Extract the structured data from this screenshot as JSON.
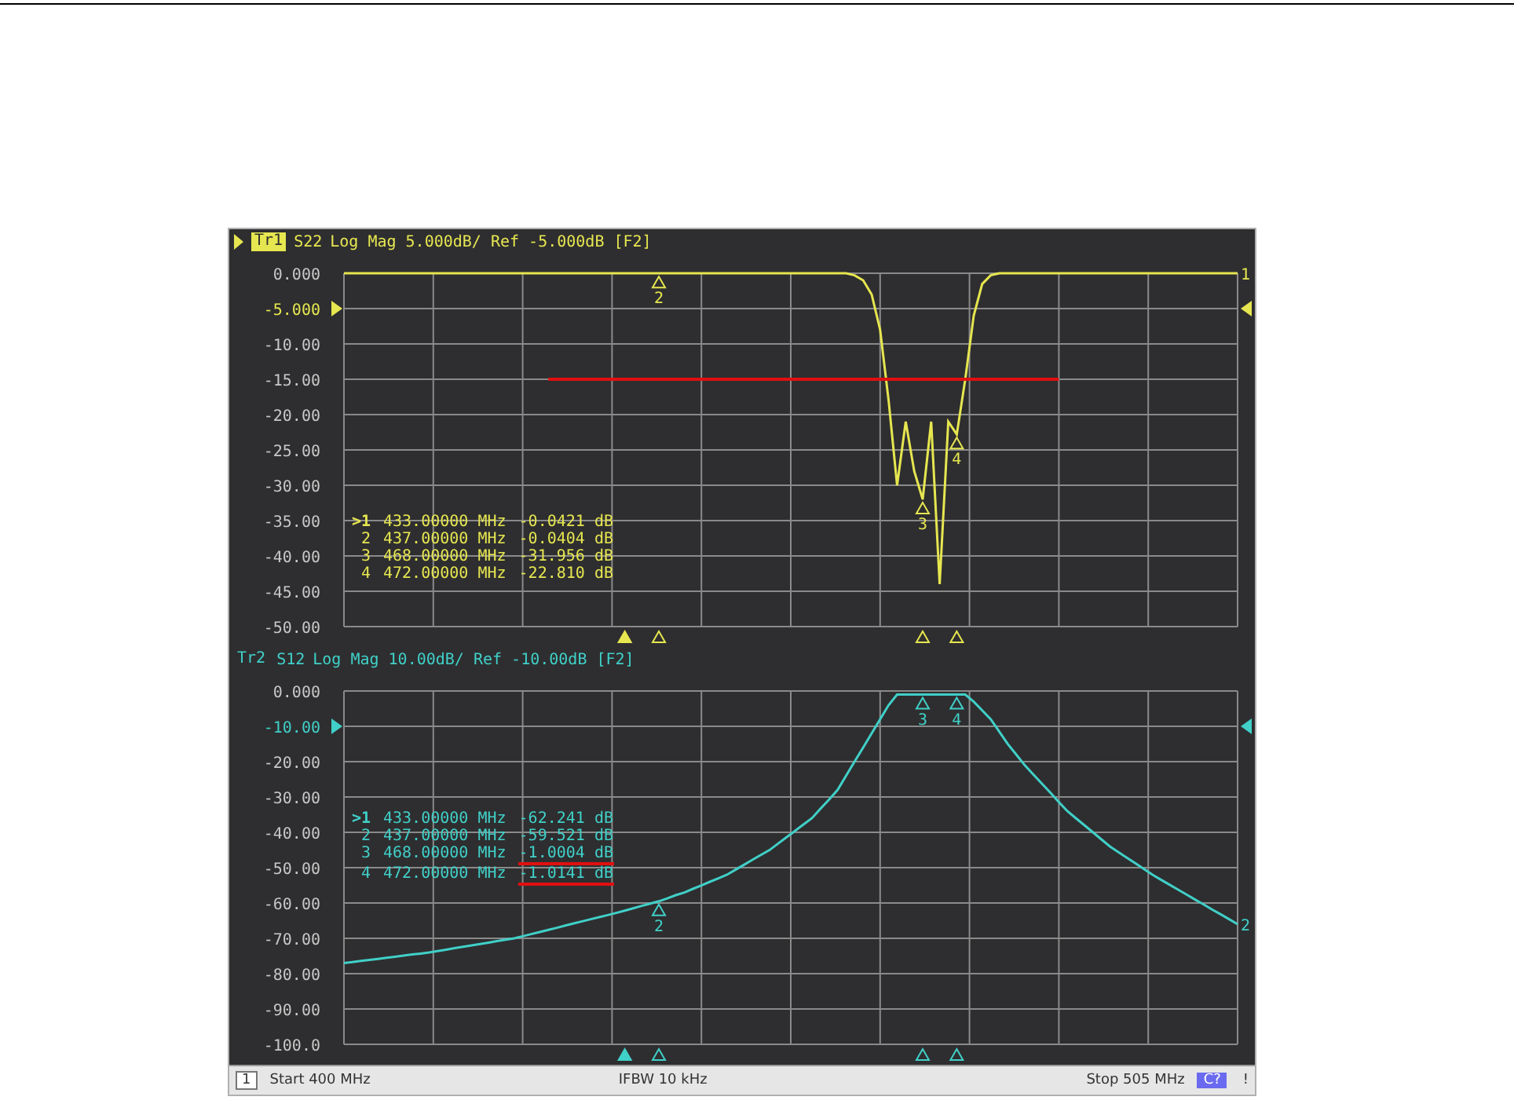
{
  "panels": [
    {
      "trace": "Tr1",
      "selected": true,
      "header": "Log Mag 5.000dB/ Ref -5.000dB [F2]",
      "trace_label": "1",
      "markers": [
        {
          "label": ">1",
          "active": true,
          "frequency": "433.00000 MHz",
          "value": "-0.0421 dB",
          "underlined": false
        },
        {
          "label": "2",
          "active": false,
          "frequency": "437.00000 MHz",
          "value": "-0.0404 dB",
          "underlined": false
        },
        {
          "label": "3",
          "active": false,
          "frequency": "468.00000 MHz",
          "value": "-31.956 dB",
          "underlined": false
        },
        {
          "label": "4",
          "active": false,
          "frequency": "472.00000 MHz",
          "value": "-22.810 dB",
          "underlined": false
        }
      ],
      "flags": [
        {
          "label": "2"
        },
        {
          "label": "3"
        },
        {
          "label": "4"
        }
      ],
      "chart_data": {
        "type": "line",
        "ylim": [
          -50,
          0
        ],
        "grid": true,
        "yticks": [
          {
            "value": 0,
            "label": "0.000"
          },
          {
            "value": -5,
            "label": "-5.000"
          },
          {
            "value": -10,
            "label": "-10.00"
          },
          {
            "value": -15,
            "label": "-15.00"
          },
          {
            "value": -20,
            "label": "-20.00"
          },
          {
            "value": -25,
            "label": "-25.00"
          },
          {
            "value": -30,
            "label": "-30.00"
          },
          {
            "value": -35,
            "label": "-35.00"
          },
          {
            "value": -40,
            "label": "-40.00"
          },
          {
            "value": -45,
            "label": "-45.00"
          },
          {
            "value": -50,
            "label": "-50.00"
          }
        ],
        "categories": [
          null,
          null,
          null,
          null,
          null,
          null,
          null,
          null,
          null,
          null,
          null,
          null,
          null,
          null,
          null,
          null,
          null,
          null,
          null,
          null,
          null,
          null,
          null,
          null,
          null,
          null,
          null,
          null,
          null,
          null,
          null,
          null,
          null,
          null,
          null,
          null,
          null,
          null,
          null,
          null,
          null,
          null,
          null,
          null,
          null,
          null,
          null,
          null,
          null,
          null,
          null,
          null,
          null,
          null,
          null,
          null,
          null,
          null,
          null,
          null,
          null,
          null,
          null,
          null,
          null,
          null,
          null,
          null,
          null,
          null,
          null,
          null,
          null,
          null,
          null,
          null,
          null,
          null,
          null,
          null,
          null,
          null,
          null,
          null,
          null,
          null,
          null,
          null,
          null,
          null,
          null,
          null,
          null,
          null,
          null,
          null,
          null,
          null,
          null,
          null,
          null,
          null,
          null,
          null,
          null,
          null
        ],
        "series": [
          {
            "name": "S22",
            "color": "#e6e650",
            "values": [
              0,
              0,
              0,
              0,
              0,
              0,
              0,
              0,
              0,
              0,
              0,
              0,
              0,
              0,
              0,
              0,
              0,
              0,
              0,
              0,
              0,
              0,
              0,
              0,
              0,
              0,
              0,
              0,
              0,
              0,
              0,
              0,
              0,
              0,
              0,
              0,
              0,
              0,
              0,
              0,
              0,
              0,
              0,
              0,
              0,
              0,
              0,
              0,
              0,
              0,
              0,
              0,
              0,
              0,
              0,
              0,
              0,
              0,
              0,
              0,
              -0.3,
              -1,
              -3,
              -8,
              -18,
              -30,
              -21,
              -28,
              -32,
              -21,
              -44,
              -21,
              -22.8,
              -15,
              -6,
              -1.5,
              -0.3,
              0,
              0,
              0,
              0,
              0,
              0,
              0,
              0,
              0,
              0,
              0,
              0,
              0,
              0,
              0,
              0,
              0,
              0,
              0,
              0,
              0,
              0,
              0,
              0,
              0,
              0,
              0,
              0,
              0
            ]
          },
          {
            "color": "#e01010",
            "values": [
              null,
              null,
              null,
              null,
              null,
              null,
              null,
              null,
              null,
              null,
              null,
              null,
              null,
              null,
              null,
              null,
              null,
              null,
              null,
              null,
              null,
              null,
              null,
              null,
              -15,
              -15,
              -15,
              -15,
              -15,
              -15,
              -15,
              -15,
              -15,
              -15,
              -15,
              -15,
              -15,
              -15,
              -15,
              -15,
              -15,
              -15,
              -15,
              -15,
              -15,
              -15,
              -15,
              -15,
              -15,
              -15,
              -15,
              -15,
              -15,
              -15,
              -15,
              -15,
              -15,
              -15,
              -15,
              -15,
              -15,
              -15,
              -15,
              -15,
              -15,
              -15,
              -15,
              -15,
              -15,
              -15,
              -15,
              -15,
              -15,
              -15,
              -15,
              -15,
              -15,
              -15,
              -15,
              -15,
              -15,
              -15,
              -15,
              -15,
              -15,
              null,
              null,
              null,
              null,
              null,
              null,
              null,
              null,
              null,
              null,
              null,
              null,
              null,
              null,
              null,
              null,
              null,
              null,
              null,
              null,
              null
            ]
          }
        ]
      }
    },
    {
      "trace": "Tr2",
      "selected": false,
      "header": "Log Mag 10.00dB/ Ref -10.00dB [F2]",
      "trace_label": "2",
      "markers": [
        {
          "label": ">1",
          "active": true,
          "frequency": "433.00000 MHz",
          "value": "-62.241 dB",
          "underlined": false
        },
        {
          "label": "2",
          "active": false,
          "frequency": "437.00000 MHz",
          "value": "-59.521 dB",
          "underlined": false
        },
        {
          "label": "3",
          "active": false,
          "frequency": "468.00000 MHz",
          "value": "-1.0004 dB",
          "underlined": true
        },
        {
          "label": "4",
          "active": false,
          "frequency": "472.00000 MHz",
          "value": "-1.0141 dB",
          "underlined": true
        }
      ],
      "flags": [
        {
          "label": "2"
        },
        {
          "label": "3"
        },
        {
          "label": "4"
        }
      ],
      "chart_data": {
        "type": "line",
        "ylim": [
          -100,
          0
        ],
        "grid": true,
        "yticks": [
          {
            "value": 0,
            "label": "0.000"
          },
          {
            "value": -10,
            "label": "-10.00"
          },
          {
            "value": -20,
            "label": "-20.00"
          },
          {
            "value": -30,
            "label": "-30.00"
          },
          {
            "value": -40,
            "label": "-40.00"
          },
          {
            "value": -50,
            "label": "-50.00"
          },
          {
            "value": -60,
            "label": "-60.00"
          },
          {
            "value": -70,
            "label": "-70.00"
          },
          {
            "value": -80,
            "label": "-80.00"
          },
          {
            "value": -90,
            "label": "-90.00"
          },
          {
            "value": -100,
            "label": "-100.0"
          }
        ],
        "categories": [
          null,
          null,
          null,
          null,
          null,
          null,
          null,
          null,
          null,
          null,
          null,
          null,
          null,
          null,
          null,
          null,
          null,
          null,
          null,
          null,
          null,
          null,
          null,
          null,
          null,
          null,
          null,
          null,
          null,
          null,
          null,
          null,
          null,
          null,
          null,
          null,
          null,
          null,
          null,
          null,
          null,
          null,
          null,
          null,
          null,
          null,
          null,
          null,
          null,
          null,
          null,
          null,
          null,
          null,
          null,
          null,
          null,
          null,
          null,
          null,
          null,
          null,
          null,
          null,
          null,
          null,
          null,
          null,
          null,
          null,
          null,
          null,
          null,
          null,
          null,
          null,
          null,
          null,
          null,
          null,
          null,
          null,
          null,
          null,
          null,
          null,
          null,
          null,
          null,
          null,
          null,
          null,
          null,
          null,
          null,
          null,
          null,
          null,
          null,
          null,
          null,
          null,
          null,
          null,
          null,
          null
        ],
        "series": [
          {
            "name": "S12",
            "color": "#40d0c8",
            "values": [
              -77,
              -76.7,
              -76.4,
              -76.1,
              -75.8,
              -75.5,
              -75.2,
              -74.9,
              -74.6,
              -74.3,
              -74,
              -73.6,
              -73.2,
              -72.8,
              -72.4,
              -72,
              -71.6,
              -71.2,
              -70.8,
              -70.4,
              -70,
              -69.4,
              -68.8,
              -68.2,
              -67.6,
              -67,
              -66.4,
              -65.8,
              -65.2,
              -64.6,
              -64,
              -63.4,
              -62.8,
              -62.2,
              -61.5,
              -60.8,
              -60.2,
              -59.5,
              -58.7,
              -57.8,
              -57,
              -56,
              -55,
              -54,
              -53,
              -52,
              -50.6,
              -49.2,
              -47.8,
              -46.4,
              -45,
              -43.2,
              -41.4,
              -39.6,
              -37.8,
              -36,
              -33.3,
              -30.7,
              -28,
              -24,
              -20,
              -16,
              -12,
              -8,
              -4,
              -1,
              -1,
              -1,
              -1,
              -1,
              -1,
              -1,
              -1,
              -1,
              -3,
              -5.5,
              -8,
              -11.5,
              -15,
              -18,
              -21,
              -23.6,
              -26.2,
              -28.8,
              -31.4,
              -34,
              -36,
              -38,
              -40,
              -42,
              -44,
              -45.6,
              -47.2,
              -48.8,
              -50.4,
              -52,
              -53.4,
              -54.8,
              -56.2,
              -57.6,
              -59,
              -60.4,
              -61.8,
              -63.2,
              -64.6,
              -66
            ]
          }
        ]
      }
    }
  ],
  "status_bar": {
    "channel": "1",
    "start": "Start 400 MHz",
    "ifbw": "IFBW 10 kHz",
    "stop": "Stop 505 MHz",
    "badge": "C?",
    "alert": "!"
  }
}
